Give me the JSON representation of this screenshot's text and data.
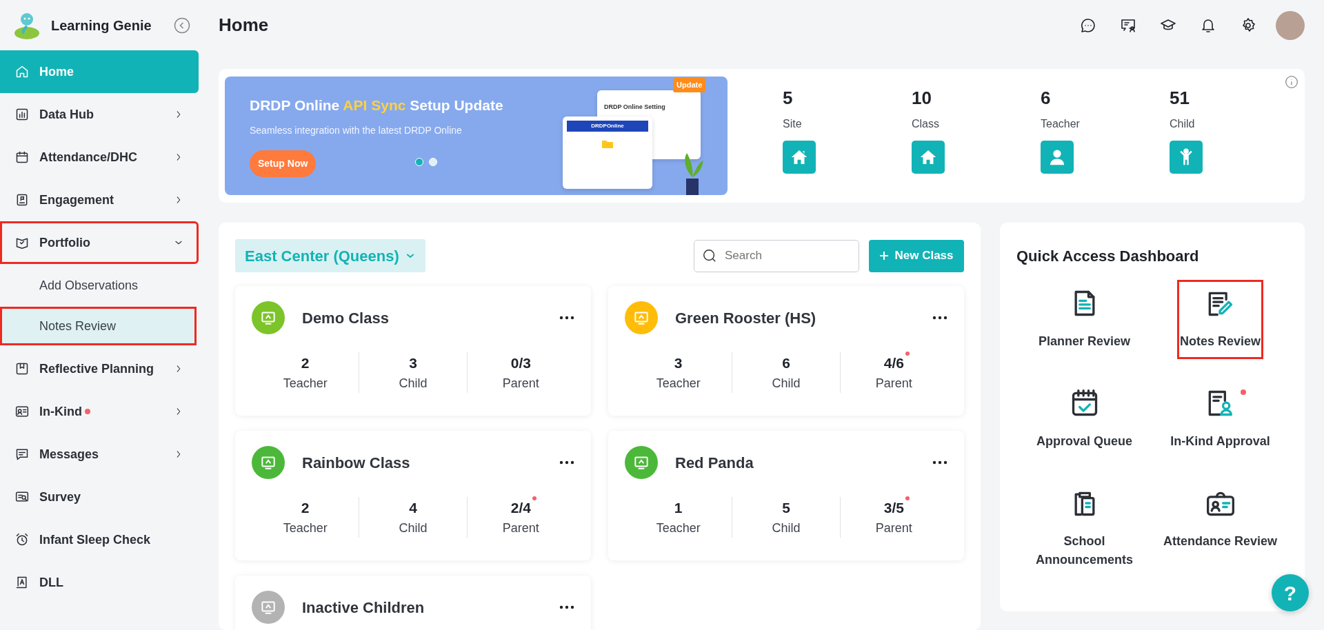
{
  "app": {
    "name": "Learning Genie"
  },
  "sidebar": {
    "items": [
      {
        "label": "Home",
        "selected": true,
        "highlighted": false,
        "has_submenu": false,
        "dot": false
      },
      {
        "label": "Data Hub",
        "selected": false,
        "highlighted": false,
        "has_submenu": true,
        "expanded": false,
        "dot": false
      },
      {
        "label": "Attendance/DHC",
        "selected": false,
        "highlighted": false,
        "has_submenu": true,
        "expanded": false,
        "dot": false
      },
      {
        "label": "Engagement",
        "selected": false,
        "highlighted": false,
        "has_submenu": true,
        "expanded": false,
        "dot": false
      },
      {
        "label": "Portfolio",
        "selected": false,
        "highlighted": true,
        "has_submenu": true,
        "expanded": true,
        "dot": false,
        "children": [
          {
            "label": "Add Observations",
            "selected": false,
            "highlighted": false
          },
          {
            "label": "Notes Review",
            "selected": true,
            "highlighted": true
          }
        ]
      },
      {
        "label": "Reflective Planning",
        "selected": false,
        "highlighted": false,
        "has_submenu": true,
        "expanded": false,
        "dot": false
      },
      {
        "label": "In-Kind",
        "selected": false,
        "highlighted": false,
        "has_submenu": true,
        "expanded": false,
        "dot": true
      },
      {
        "label": "Messages",
        "selected": false,
        "highlighted": false,
        "has_submenu": true,
        "expanded": false,
        "dot": false
      },
      {
        "label": "Survey",
        "selected": false,
        "highlighted": false,
        "has_submenu": false,
        "dot": false
      },
      {
        "label": "Infant Sleep Check",
        "selected": false,
        "highlighted": false,
        "has_submenu": false,
        "dot": false
      },
      {
        "label": "DLL",
        "selected": false,
        "highlighted": false,
        "has_submenu": false,
        "dot": false
      }
    ]
  },
  "header": {
    "title": "Home"
  },
  "banner": {
    "title": "DRDP Online **API Sync** Setup Update",
    "subtitle": "Seamless integration with the latest DRDP Online",
    "button": "Setup Now",
    "illustration": {
      "window_title": "DRDP Online Setting",
      "badge": "Update",
      "logo": "DRDPOnline"
    },
    "slides": [
      {
        "selected": true
      },
      {
        "selected": false
      }
    ]
  },
  "stats": [
    {
      "value": "5",
      "label": "Site"
    },
    {
      "value": "10",
      "label": "Class"
    },
    {
      "value": "6",
      "label": "Teacher"
    },
    {
      "value": "51",
      "label": "Child"
    }
  ],
  "classes": {
    "site": "East Center (Queens)",
    "search": {
      "placeholder": "Search"
    },
    "new_button": "New Class",
    "cards": [
      {
        "name": "Demo Class",
        "color": "#7cc42a",
        "stats": [
          {
            "value": "2",
            "label": "Teacher",
            "dot": false
          },
          {
            "value": "3",
            "label": "Child",
            "dot": false
          },
          {
            "value": "0/3",
            "label": "Parent",
            "dot": false
          }
        ]
      },
      {
        "name": "Green Rooster (HS)",
        "color": "#ffbd0a",
        "stats": [
          {
            "value": "3",
            "label": "Teacher",
            "dot": false
          },
          {
            "value": "6",
            "label": "Child",
            "dot": false
          },
          {
            "value": "4/6",
            "label": "Parent",
            "dot": true
          }
        ]
      },
      {
        "name": "Rainbow Class",
        "color": "#4cb83a",
        "stats": [
          {
            "value": "2",
            "label": "Teacher",
            "dot": false
          },
          {
            "value": "4",
            "label": "Child",
            "dot": false
          },
          {
            "value": "2/4",
            "label": "Parent",
            "dot": true
          }
        ]
      },
      {
        "name": "Red Panda",
        "color": "#4cb83a",
        "stats": [
          {
            "value": "1",
            "label": "Teacher",
            "dot": false
          },
          {
            "value": "5",
            "label": "Child",
            "dot": false
          },
          {
            "value": "3/5",
            "label": "Parent",
            "dot": true
          }
        ]
      },
      {
        "name": "Inactive Children",
        "color": "#b3b3b3"
      }
    ]
  },
  "quick_access": {
    "title": "Quick Access Dashboard",
    "items": [
      {
        "label": "Planner Review",
        "highlighted": false,
        "dot": false
      },
      {
        "label": "Notes Review",
        "highlighted": true,
        "dot": false
      },
      {
        "label": "Approval Queue",
        "highlighted": false,
        "dot": false
      },
      {
        "label": "In-Kind Approval",
        "highlighted": false,
        "dot": true
      },
      {
        "label": "School Announcements",
        "highlighted": false,
        "dot": false
      },
      {
        "label": "Attendance Review",
        "highlighted": false,
        "dot": false
      }
    ]
  },
  "help": {
    "label": "?"
  }
}
